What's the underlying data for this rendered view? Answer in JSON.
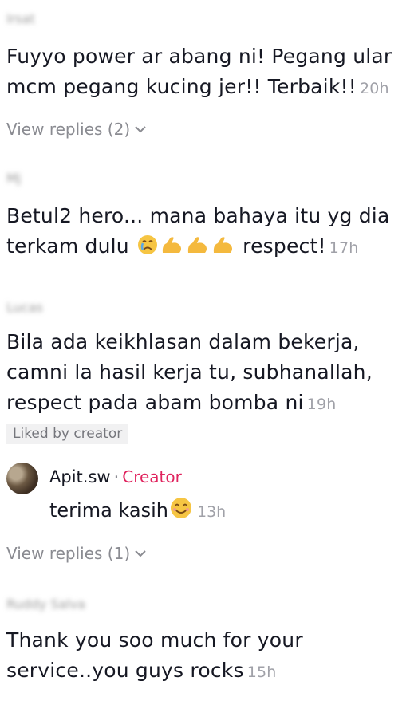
{
  "comments": [
    {
      "username": "Irsat",
      "text": "Fuyyo power ar abang ni! Pegang ular mcm pegang kucing jer!! Terbaik!!",
      "time": "20h",
      "view_replies": "View replies (2)"
    },
    {
      "username": "Mj",
      "text_before_emoji": "Betul2 hero... mana bahaya itu yg dia terkam dulu",
      "text_after_emoji": "respect!",
      "time": "17h"
    },
    {
      "username": "Lucas",
      "text": "Bila ada keikhlasan dalam bekerja, camni la hasil kerja tu, subhanallah, respect pada abam bomba ni",
      "time": "19h",
      "liked_badge": "Liked by creator",
      "reply": {
        "username": "Apit.sw",
        "separator": "·",
        "role": "Creator",
        "text": "terima kasih",
        "time": "13h"
      },
      "view_replies": "View replies (1)"
    },
    {
      "username": "Ruddy Salva",
      "text": "Thank you soo much for your service..you guys rocks",
      "time": "15h"
    }
  ],
  "icons": {
    "chevron": "chevron-down-icon",
    "emoji_cry": "crying-face-icon",
    "emoji_muscle": "flexed-biceps-icon",
    "emoji_smile": "smiling-face-icon"
  },
  "colors": {
    "creator": "#e0245e",
    "time": "#a0a1a8",
    "secondary": "#8a8b91"
  }
}
